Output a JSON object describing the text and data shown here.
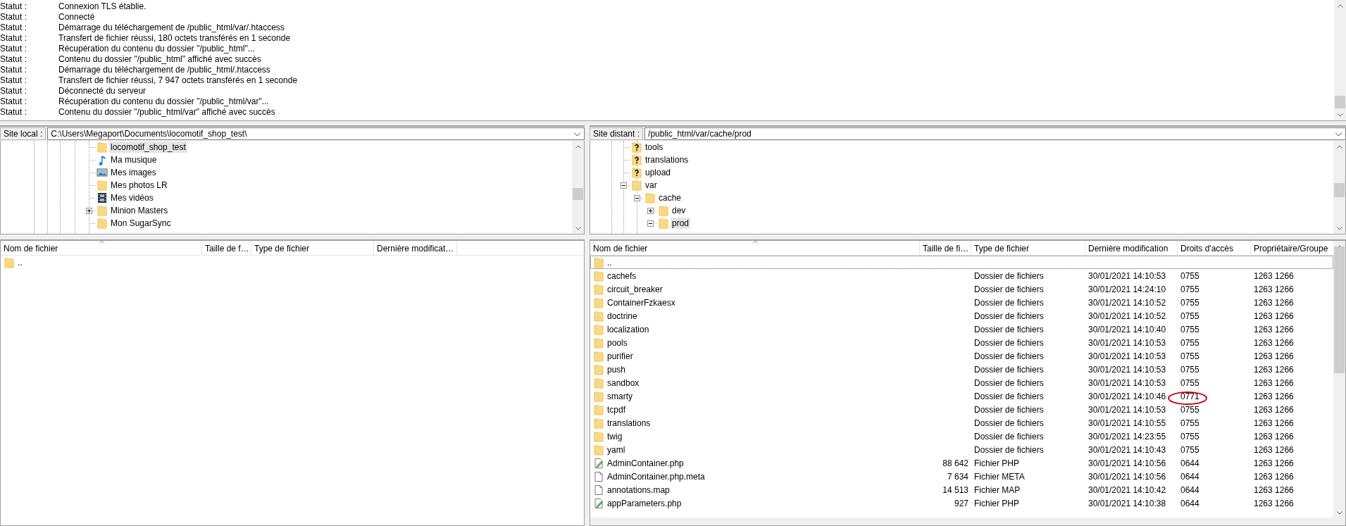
{
  "log": [
    {
      "label": "Statut :",
      "message": "Connexion TLS établie."
    },
    {
      "label": "Statut :",
      "message": "Connecté"
    },
    {
      "label": "Statut :",
      "message": "Démarrage du téléchargement de /public_html/var/.htaccess"
    },
    {
      "label": "Statut :",
      "message": "Transfert de fichier réussi, 180 octets transférés en 1 seconde"
    },
    {
      "label": "Statut :",
      "message": "Récupération du contenu du dossier \"/public_html\"..."
    },
    {
      "label": "Statut :",
      "message": "Contenu du dossier \"/public_html\" affiché avec succès"
    },
    {
      "label": "Statut :",
      "message": "Démarrage du téléchargement de /public_html/.htaccess"
    },
    {
      "label": "Statut :",
      "message": "Transfert de fichier réussi, 7 947 octets transférés en 1 seconde"
    },
    {
      "label": "Statut :",
      "message": "Déconnecté du serveur"
    },
    {
      "label": "Statut :",
      "message": "Récupération du contenu du dossier \"/public_html/var\"..."
    },
    {
      "label": "Statut :",
      "message": "Contenu du dossier \"/public_html/var\" affiché avec succès"
    }
  ],
  "local": {
    "site_label": "Site local :",
    "path": "C:\\Users\\Megaport\\Documents\\locomotif_shop_test\\",
    "tree": [
      {
        "name": "locomotif_shop_test",
        "kind": "folder",
        "selected": true
      },
      {
        "name": "Ma musique",
        "kind": "music",
        "selected": false
      },
      {
        "name": "Mes images",
        "kind": "images",
        "selected": false
      },
      {
        "name": "Mes photos LR",
        "kind": "folder",
        "selected": false
      },
      {
        "name": "Mes vidéos",
        "kind": "videos",
        "selected": false
      },
      {
        "name": "Minion Masters",
        "kind": "folder",
        "selected": false,
        "expanded": false
      },
      {
        "name": "Mon SugarSync",
        "kind": "folder",
        "selected": false
      }
    ],
    "list": {
      "columns": [
        "Nom de fichier",
        "Taille de f…",
        "Type de fichier",
        "Dernière modificat…"
      ],
      "rows": [
        {
          "kind": "folder",
          "name": ".."
        }
      ]
    }
  },
  "remote": {
    "site_label": "Site distant :",
    "path": "/public_html/var/cache/prod",
    "tree": [
      {
        "name": "tools",
        "kind": "unknown",
        "selected": false
      },
      {
        "name": "translations",
        "kind": "unknown",
        "selected": false
      },
      {
        "name": "upload",
        "kind": "unknown",
        "selected": false
      },
      {
        "name": "var",
        "kind": "folder",
        "selected": false,
        "expanded": true,
        "children": [
          {
            "name": "cache",
            "kind": "folder",
            "selected": false,
            "expanded": true,
            "children": [
              {
                "name": "dev",
                "kind": "folder",
                "selected": false,
                "expanded": false
              },
              {
                "name": "prod",
                "kind": "folder",
                "selected": true,
                "expanded": true
              }
            ]
          }
        ]
      }
    ],
    "list": {
      "columns": [
        "Nom de fichier",
        "Taille de fi…",
        "Type de fichier",
        "Dernière modification",
        "Droits d'accès",
        "Propriétaire/Groupe"
      ],
      "rows": [
        {
          "kind": "folder",
          "name": "..",
          "focused": true,
          "circled": false
        },
        {
          "kind": "folder",
          "name": "cachefs",
          "type": "Dossier de fichiers",
          "modified": "30/01/2021 14:10:53",
          "rights": "0755",
          "owner": "1263 1266",
          "focused": false,
          "circled": false
        },
        {
          "kind": "folder",
          "name": "circuit_breaker",
          "type": "Dossier de fichiers",
          "modified": "30/01/2021 14:24:10",
          "rights": "0755",
          "owner": "1263 1266",
          "focused": false,
          "circled": false
        },
        {
          "kind": "folder",
          "name": "ContainerFzkaesx",
          "type": "Dossier de fichiers",
          "modified": "30/01/2021 14:10:52",
          "rights": "0755",
          "owner": "1263 1266",
          "focused": false,
          "circled": false
        },
        {
          "kind": "folder",
          "name": "doctrine",
          "type": "Dossier de fichiers",
          "modified": "30/01/2021 14:10:52",
          "rights": "0755",
          "owner": "1263 1266",
          "focused": false,
          "circled": false
        },
        {
          "kind": "folder",
          "name": "localization",
          "type": "Dossier de fichiers",
          "modified": "30/01/2021 14:10:40",
          "rights": "0755",
          "owner": "1263 1266",
          "focused": false,
          "circled": false
        },
        {
          "kind": "folder",
          "name": "pools",
          "type": "Dossier de fichiers",
          "modified": "30/01/2021 14:10:53",
          "rights": "0755",
          "owner": "1263 1266",
          "focused": false,
          "circled": false
        },
        {
          "kind": "folder",
          "name": "purifier",
          "type": "Dossier de fichiers",
          "modified": "30/01/2021 14:10:53",
          "rights": "0755",
          "owner": "1263 1266",
          "focused": false,
          "circled": false
        },
        {
          "kind": "folder",
          "name": "push",
          "type": "Dossier de fichiers",
          "modified": "30/01/2021 14:10:53",
          "rights": "0755",
          "owner": "1263 1266",
          "focused": false,
          "circled": false
        },
        {
          "kind": "folder",
          "name": "sandbox",
          "type": "Dossier de fichiers",
          "modified": "30/01/2021 14:10:53",
          "rights": "0755",
          "owner": "1263 1266",
          "focused": false,
          "circled": false
        },
        {
          "kind": "folder",
          "name": "smarty",
          "type": "Dossier de fichiers",
          "modified": "30/01/2021 14:10:46",
          "rights": "0771",
          "owner": "1263 1266",
          "focused": false,
          "circled": true
        },
        {
          "kind": "folder",
          "name": "tcpdf",
          "type": "Dossier de fichiers",
          "modified": "30/01/2021 14:10:53",
          "rights": "0755",
          "owner": "1263 1266",
          "focused": false,
          "circled": false
        },
        {
          "kind": "folder",
          "name": "translations",
          "type": "Dossier de fichiers",
          "modified": "30/01/2021 14:10:55",
          "rights": "0755",
          "owner": "1263 1266",
          "focused": false,
          "circled": false
        },
        {
          "kind": "folder",
          "name": "twig",
          "type": "Dossier de fichiers",
          "modified": "30/01/2021 14:23:55",
          "rights": "0755",
          "owner": "1263 1266",
          "focused": false,
          "circled": false
        },
        {
          "kind": "folder",
          "name": "yaml",
          "type": "Dossier de fichiers",
          "modified": "30/01/2021 14:10:43",
          "rights": "0755",
          "owner": "1263 1266",
          "focused": false,
          "circled": false
        },
        {
          "kind": "php",
          "name": "AdminContainer.php",
          "size": "88 642",
          "type": "Fichier PHP",
          "modified": "30/01/2021 14:10:56",
          "rights": "0644",
          "owner": "1263 1266",
          "focused": false,
          "circled": false
        },
        {
          "kind": "file",
          "name": "AdminContainer.php.meta",
          "size": "7 634",
          "type": "Fichier META",
          "modified": "30/01/2021 14:10:56",
          "rights": "0644",
          "owner": "1263 1266",
          "focused": false,
          "circled": false
        },
        {
          "kind": "file",
          "name": "annotations.map",
          "size": "14 513",
          "type": "Fichier MAP",
          "modified": "30/01/2021 14:10:42",
          "rights": "0644",
          "owner": "1263 1266",
          "focused": false,
          "circled": false
        },
        {
          "kind": "php",
          "name": "appParameters.php",
          "size": "927",
          "type": "Fichier PHP",
          "modified": "30/01/2021 14:10:38",
          "rights": "0644",
          "owner": "1263 1266",
          "focused": false,
          "circled": false
        }
      ]
    }
  }
}
